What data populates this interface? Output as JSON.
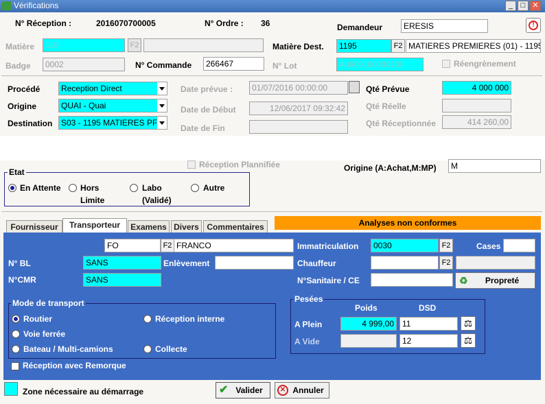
{
  "window": {
    "title": "Vérifications",
    "minimize": "_",
    "maximize": "□",
    "close": "✕"
  },
  "header": {
    "reception_label": "N° Réception :",
    "reception_value": "2016070700005",
    "ordre_label": "N° Ordre :",
    "ordre_value": "36",
    "demandeur_label": "Demandeur",
    "demandeur_value": "ERESIS",
    "matiere_label": "Matière",
    "matiere_value": "119",
    "matiere_desc": "",
    "matiere_dest_label": "Matière Dest.",
    "matiere_dest_value": "1195",
    "matiere_dest_desc": "MATIERES PREMIERES (01) - 1195",
    "badge_label": "Badge",
    "badge_value": "0002",
    "commande_label": "N° Commande",
    "commande_value": "266467",
    "lot_label": "N° Lot",
    "lot_value": "Ad60916003010I",
    "regrenement_label": "Réengrènement",
    "f2": "F2"
  },
  "process": {
    "procede_label": "Procédé",
    "procede_value": "Reception Direct",
    "origine_label": "Origine",
    "origine_value": "QUAI - Quai",
    "destination_label": "Destination",
    "destination_value": "S03 - 1195 MATIERES PF",
    "date_prevue_label": "Date prévue :",
    "date_prevue_value": "01/07/2016 00:00:00",
    "date_debut_label": "Date de Début",
    "date_debut_value": "12/06/2017 09:32:42",
    "date_fin_label": "Date de Fin",
    "date_fin_value": "",
    "qte_prevue_label": "Qté Prévue",
    "qte_prevue_value": "4 000 000",
    "qte_reelle_label": "Qté Réelle",
    "qte_reelle_value": "",
    "qte_recep_label": "Qté Réceptionnée",
    "qte_recep_value": "414 260,00",
    "reception_planifiee_label": "Réception Plannifiée",
    "origine_achat_label": "Origine (A:Achat,M:MP)",
    "origine_achat_value": "M"
  },
  "etat": {
    "title": "Etat",
    "options": [
      "En Attente",
      "Hors Limite",
      "Labo (Validé)",
      "Autre"
    ],
    "opt1_l1": "En Attente",
    "opt2_l1": "Hors",
    "opt2_l2": "Limite",
    "opt3_l1": "Labo",
    "opt3_l2": "(Validé)",
    "opt4_l1": "Autre"
  },
  "tabs": {
    "t1": "Fournisseur",
    "t2": "Transporteur",
    "t3": "Examens",
    "t4": "Divers",
    "t5": "Commentaires"
  },
  "alert": "Analyses non conformes",
  "transport": {
    "code_value": "FO",
    "code_desc": "FRANCO",
    "bl_label": "N° BL",
    "bl_value": "SANS",
    "enlevement_label": "Enlèvement",
    "enlevement_value": "",
    "cmr_label": "N°CMR",
    "cmr_value": "SANS",
    "immat_label": "Immatriculation",
    "immat_value": "0030",
    "cases_label": "Cases",
    "cases_value": "",
    "chauffeur_label": "Chauffeur",
    "chauffeur_value": "",
    "chauffeur_desc": "",
    "sanitaire_label": "N°Sanitaire / CE",
    "sanitaire_value": "",
    "proprete_label": "Propreté",
    "mode_title": "Mode de transport",
    "mode_routier": "Routier",
    "mode_voie": "Voie ferrée",
    "mode_bateau": "Bateau / Multi-camions",
    "mode_interne": "Réception interne",
    "mode_collecte": "Collecte",
    "remorque_label": "Réception avec Remorque",
    "pesees_title": "Pesées",
    "poids_header": "Poids",
    "dsd_header": "DSD",
    "plein_label": "A Plein",
    "plein_poids": "4 999,00",
    "plein_dsd": "11",
    "vide_label": "A Vide",
    "vide_poids": "",
    "vide_dsd": "12",
    "f2": "F2"
  },
  "footer": {
    "legend_label": "Zone nécessaire au démarrage",
    "valider": "Valider",
    "annuler": "Annuler"
  },
  "colors": {
    "required": "#00ffff",
    "alert": "#ff9900",
    "panel": "#3d6cc4"
  }
}
